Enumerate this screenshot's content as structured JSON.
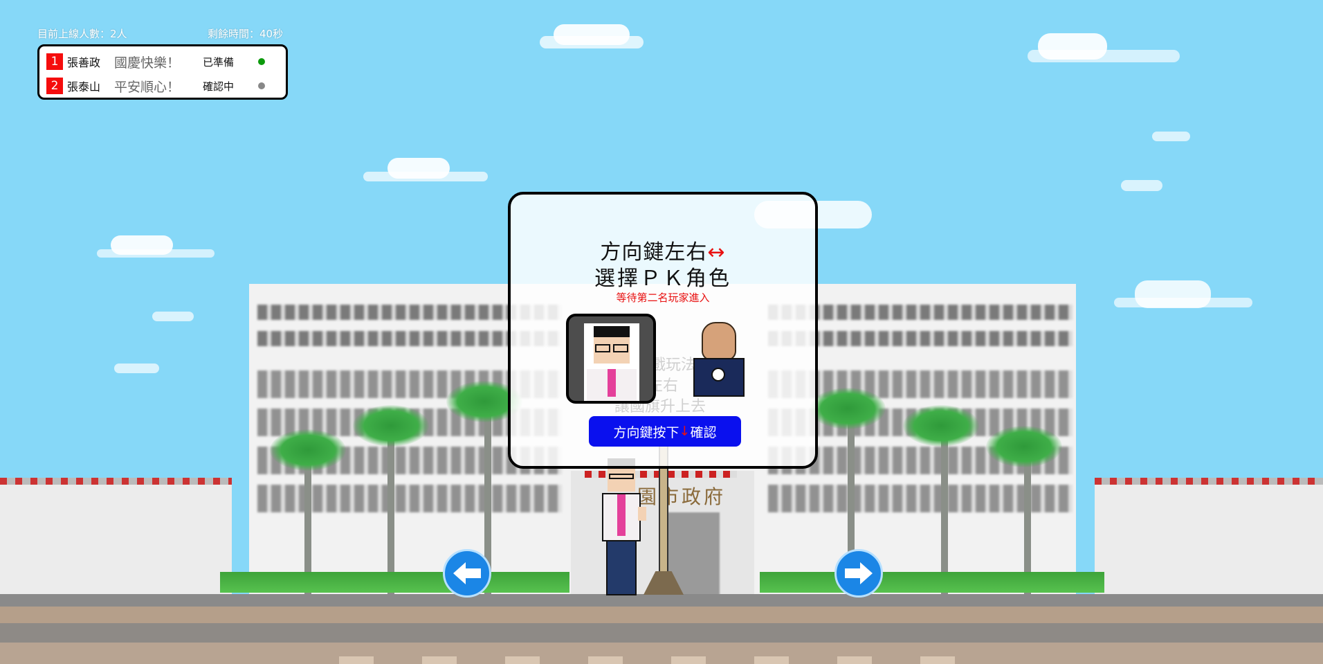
{
  "hud": {
    "online_count": "目前上線人數：2人",
    "time_left": "剩餘時間：40秒"
  },
  "players": [
    {
      "number": "1",
      "name": "張善政",
      "message": "國慶快樂！",
      "status": "已準備",
      "dot_color": "#0c9a0c"
    },
    {
      "number": "2",
      "name": "張泰山",
      "message": "平安順心！",
      "status": "確認中",
      "dot_color": "#888888"
    }
  ],
  "modal": {
    "line1": "方向鍵左右",
    "line1_arrow": "↔",
    "line2": "選擇ＰＫ角色",
    "waiting": "等待第二名玩家進入",
    "confirm_prefix": "方向鍵按下",
    "confirm_arrow": "↓",
    "confirm_suffix": "確認"
  },
  "background": {
    "sign_text": "園市政府",
    "faded_hint_1": "遊戲玩法：",
    "faded_hint_2": "點擊方向鍵左右",
    "faded_hint_3": "讓國旗升上去"
  },
  "colors": {
    "sky": "#86d8f8",
    "confirm_button": "#0a10ee",
    "accent_red": "#e81010",
    "nav_button": "#1b86e6"
  },
  "icons": {
    "left_nav": "arrow-left-icon",
    "right_nav": "arrow-right-icon"
  }
}
